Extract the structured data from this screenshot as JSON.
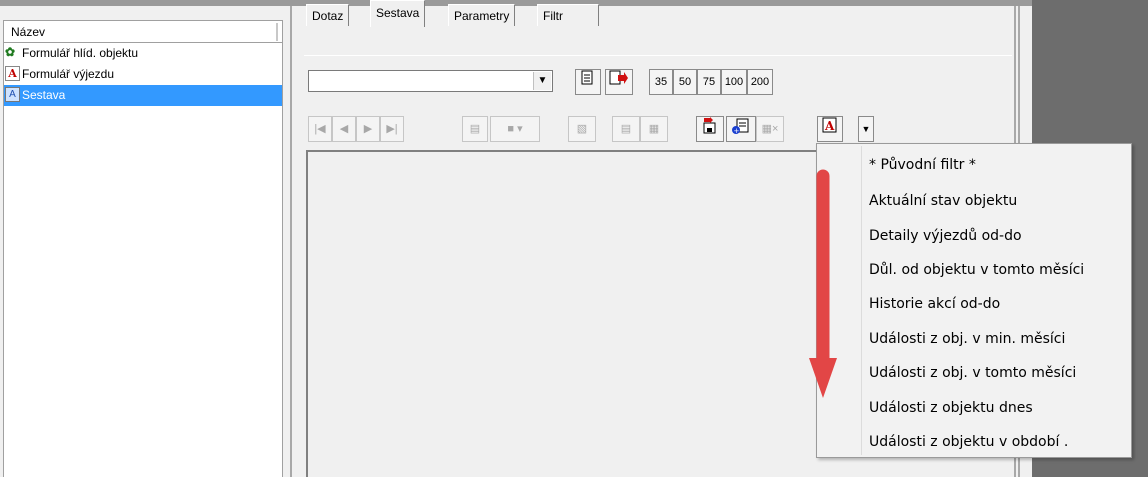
{
  "left_list": {
    "header": "Název",
    "items": [
      {
        "label": "Formulář hlíd. objektu",
        "icon": "tree-icon",
        "selected": false
      },
      {
        "label": "Formulář výjezdu",
        "icon": "pdf-form-icon",
        "selected": false
      },
      {
        "label": "Sestava",
        "icon": "report-icon",
        "selected": true
      }
    ]
  },
  "tabs": [
    "Dotaz",
    "Sestava",
    "Parametry",
    "Filtr"
  ],
  "active_tab": "Sestava",
  "toolbar": {
    "combo_value": "",
    "zoom_labels": [
      "35",
      "50",
      "75",
      "100",
      "200"
    ]
  },
  "menu": {
    "items": [
      "* Původní filtr *",
      "Aktuální stav objektu",
      "Detaily výjezdů od-do",
      "Důl. od objektu v tomto měsíci",
      "Historie akcí od-do",
      "Události z obj. v min. měsíci",
      "Události z obj. v tomto měsíci",
      "Události z objektu dnes",
      "Události z objektu v období ."
    ]
  },
  "colors": {
    "selection": "#3399ff",
    "annotation_arrow": "#e24646",
    "window_bg": "#f0f0f0",
    "dark_panel": "#6d6d6d"
  }
}
